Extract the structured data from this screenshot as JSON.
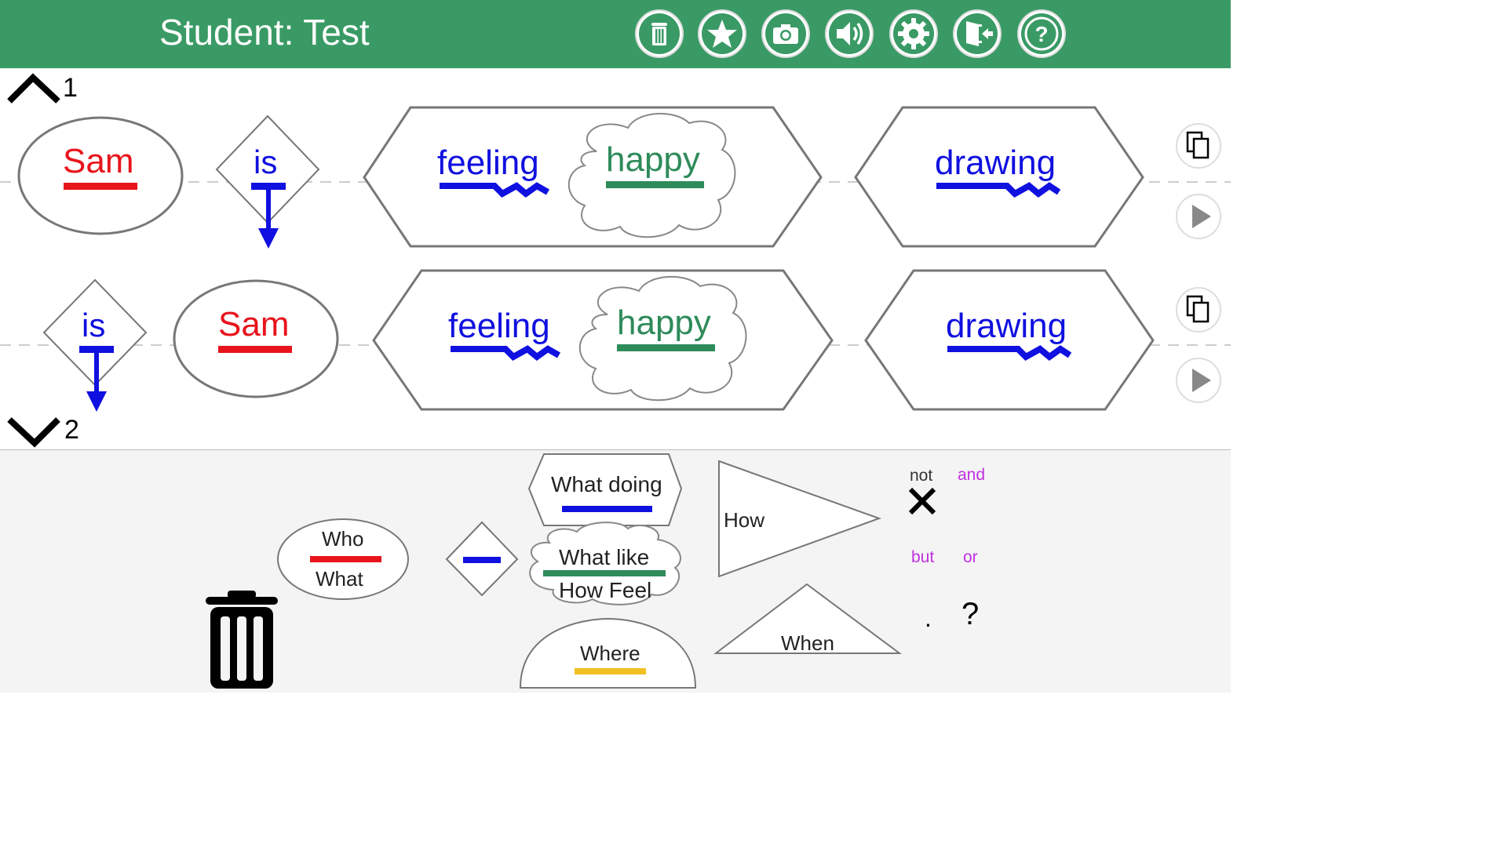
{
  "header": {
    "title": "Student: Test",
    "buttons": [
      "trash-icon",
      "star-icon",
      "camera-icon",
      "speaker-icon",
      "gear-icon",
      "exit-icon",
      "help-icon"
    ]
  },
  "nav": {
    "up_number": "1",
    "down_number": "2"
  },
  "sentences": [
    {
      "subject": "Sam",
      "verb": "is",
      "what_doing": "feeling",
      "what_like": "happy",
      "second_doing": "drawing"
    },
    {
      "verb": "is",
      "subject": "Sam",
      "what_doing": "feeling",
      "what_like": "happy",
      "second_doing": "drawing"
    }
  ],
  "palette": {
    "who_top": "Who",
    "who_bottom": "What",
    "what_doing": "What doing",
    "what_like_top": "What like",
    "what_like_bottom": "How Feel",
    "where": "Where",
    "how": "How",
    "when": "When",
    "not": "not",
    "and": "and",
    "but": "but",
    "or": "or",
    "period": ".",
    "question": "?"
  },
  "colors": {
    "header": "#3a9a65",
    "subject": "#e8141c",
    "verb": "#1010e0",
    "adjective": "#2e8b5a",
    "where": "#f0c020",
    "conjunction": "#c030e0"
  }
}
